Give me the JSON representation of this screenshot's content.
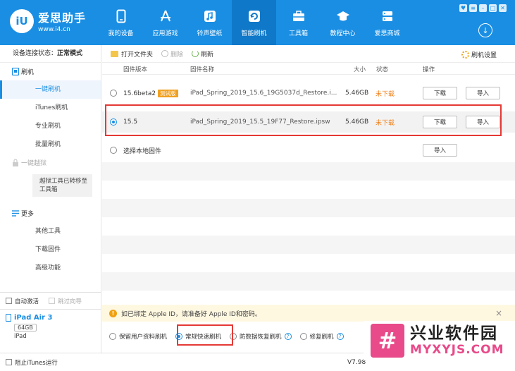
{
  "header": {
    "logo_mark": "iU",
    "logo_title": "爱思助手",
    "logo_url": "www.i4.cn",
    "nav": [
      {
        "label": "我的设备",
        "icon": "phone-icon"
      },
      {
        "label": "应用游戏",
        "icon": "appstore-icon"
      },
      {
        "label": "铃声壁纸",
        "icon": "music-icon"
      },
      {
        "label": "智能刷机",
        "icon": "flash-icon"
      },
      {
        "label": "工具箱",
        "icon": "toolbox-icon"
      },
      {
        "label": "教程中心",
        "icon": "graduation-cap-icon"
      },
      {
        "label": "爱思商城",
        "icon": "shop-icon"
      }
    ],
    "active_nav": "智能刷机",
    "window_controls": [
      "♥",
      "≡",
      "–",
      "□",
      "✕"
    ],
    "download_glyph": "↓"
  },
  "sidebar": {
    "status_label": "设备连接状态：",
    "status_value": "正常模式",
    "group_flash": "刷机",
    "items": [
      {
        "label": "一键刷机",
        "active": true
      },
      {
        "label": "iTunes刷机"
      },
      {
        "label": "专业刷机"
      },
      {
        "label": "批量刷机"
      }
    ],
    "group_jailbreak": "一键越狱",
    "jb_note_line1": "越狱工具已转移至",
    "jb_note_line2": "工具箱",
    "group_more": "更多",
    "more_items": [
      {
        "label": "其他工具"
      },
      {
        "label": "下载固件"
      },
      {
        "label": "高级功能"
      }
    ],
    "auto_activate": "自动激活",
    "skip_guide": "跳过向导",
    "device_name": "iPad Air 3",
    "device_capacity": "64GB",
    "device_type": "iPad"
  },
  "toolbar": {
    "open_folder": "打开文件夹",
    "delete": "删除",
    "refresh": "刷新",
    "settings": "刷机设置"
  },
  "table": {
    "headers": {
      "version": "固件版本",
      "name": "固件名称",
      "size": "大小",
      "status": "状态",
      "action": "操作"
    },
    "rows": [
      {
        "version": "15.6beta2",
        "badge": "测试版",
        "name": "iPad_Spring_2019_15.6_19G5037d_Restore.i...",
        "size": "5.46GB",
        "status": "未下载",
        "download": "下载",
        "import": "导入",
        "selected": false
      },
      {
        "version": "15.5",
        "name": "iPad_Spring_2019_15.5_19F77_Restore.ipsw",
        "size": "5.46GB",
        "status": "未下载",
        "download": "下载",
        "import": "导入",
        "selected": true
      }
    ],
    "local_label": "选择本地固件",
    "local_import": "导入"
  },
  "notice": {
    "icon": "!",
    "text": "如已绑定 Apple ID，请准备好 Apple ID和密码。",
    "close": "×"
  },
  "modes": [
    {
      "label": "保留用户资料刷机",
      "selected": false,
      "help": false
    },
    {
      "label": "常规快速刷机",
      "selected": true,
      "help": false
    },
    {
      "label": "防数据恢复刷机",
      "selected": false,
      "help": true
    },
    {
      "label": "修复刷机",
      "selected": false,
      "help": true
    }
  ],
  "footer": {
    "block_itunes": "阻止iTunes运行",
    "version": "V7.98"
  },
  "watermark": {
    "logo": "#",
    "cn": "兴业软件园",
    "en": "MYXYJS.COM"
  }
}
